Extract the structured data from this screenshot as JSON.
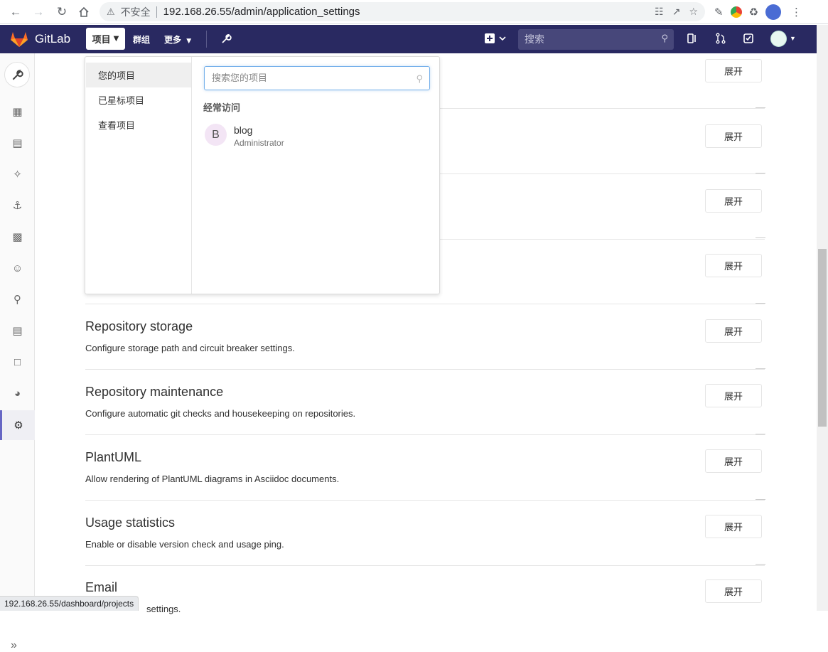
{
  "browser": {
    "back_icon": "arrow-left-icon",
    "forward_icon": "arrow-right-icon",
    "reload_icon": "reload-icon",
    "home_icon": "home-icon",
    "insecure_label": "不安全",
    "url": "192.168.26.55/admin/application_settings"
  },
  "header": {
    "brand": "GitLab",
    "menu_projects": "项目",
    "menu_groups": "群组",
    "menu_more": "更多",
    "search_placeholder": "搜索",
    "colors": {
      "header_bg": "#292961",
      "search_bg": "#47477a"
    }
  },
  "dropdown": {
    "nav_items": [
      "您的项目",
      "已星标项目",
      "查看项目"
    ],
    "search_placeholder": "搜索您的项目",
    "frequent_heading": "经常访问",
    "project": {
      "avatar_letter": "B",
      "name": "blog",
      "namespace": "Administrator"
    }
  },
  "sections": [
    {
      "title": "",
      "description": "",
      "button": "展开"
    },
    {
      "title": "",
      "description": "",
      "button": "展开"
    },
    {
      "title": "",
      "description": "",
      "button": "展开"
    },
    {
      "title": "",
      "description": "",
      "button": "展开"
    },
    {
      "title": "Repository storage",
      "description": "Configure storage path and circuit breaker settings.",
      "button": "展开"
    },
    {
      "title": "Repository maintenance",
      "description": "Configure automatic git checks and housekeeping on repositories.",
      "button": "展开"
    },
    {
      "title": "PlantUML",
      "description": "Allow rendering of PlantUML diagrams in Asciidoc documents.",
      "button": "展开"
    },
    {
      "title": "Usage statistics",
      "description": "Enable or disable version check and usage ping.",
      "button": "展开"
    },
    {
      "title": "Email",
      "description": "settings.",
      "button": "展开"
    }
  ],
  "status_bar": {
    "url": "192.168.26.55/dashboard/projects"
  }
}
